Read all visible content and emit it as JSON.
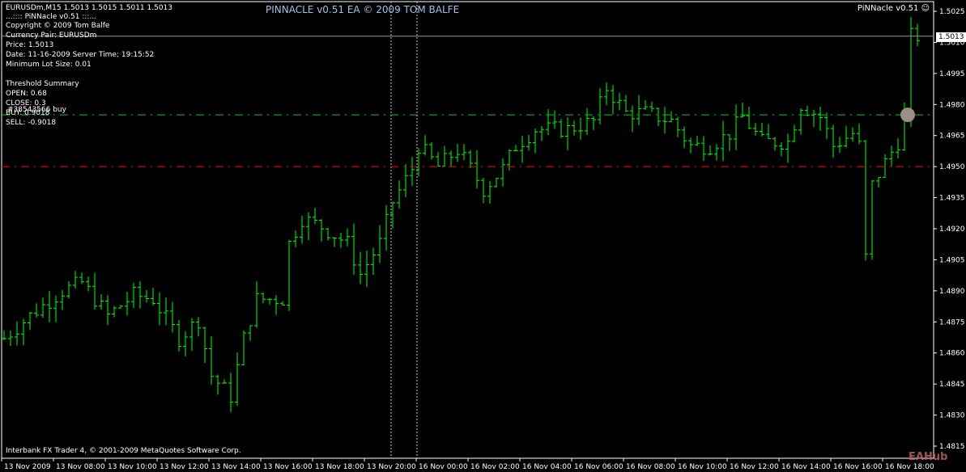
{
  "header": {
    "symbol_line": "EURUSDm,M15  1.5013 1.5015 1.5011 1.5013",
    "ea_name": "...:::: PiNNacle v0.51 :::...",
    "title": "PINNACLE v0.51 EA © 2009 TOM BALFE",
    "ea_badge": "PiNNacle v0.51 ☺"
  },
  "info": [
    "Copyright © 2009 Tom Balfe",
    "Currency Pair: EURUSDm",
    "Price:  1.5013",
    "Date: 11-16-2009 Server Time: 19:15:52",
    "Minimum Lot Size: 0.01",
    "",
    "Threshold Summary",
    "OPEN: 0.68",
    "CLOSE: 0.3",
    "BUY: 0.9018",
    "SELL: -0.9018"
  ],
  "order_label": "#38543566 buy",
  "current_price": "1.5013",
  "footer": "Interbank FX Trader 4, © 2001-2009 MetaQuotes Software Corp.",
  "watermark": "EAHub",
  "colors": {
    "bars": "#00ff00",
    "buy_line": "#00cc00",
    "sell_line": "#ff0000",
    "title": "#9cc3e6"
  },
  "chart_data": {
    "type": "ohlc",
    "timeframe": "M15",
    "price_levels": {
      "buy": 1.4975,
      "sell": 1.495,
      "current": 1.5013
    },
    "ylim": [
      1.481,
      1.503
    ],
    "y_ticks": [
      "1.5025",
      "1.5010",
      "1.4995",
      "1.4980",
      "1.4965",
      "1.4950",
      "1.4935",
      "1.4920",
      "1.4905",
      "1.4890",
      "1.4875",
      "1.4860",
      "1.4845",
      "1.4830",
      "1.4815"
    ],
    "x_ticks": [
      "13 Nov 2009",
      "13 Nov 08:00",
      "13 Nov 10:00",
      "13 Nov 12:00",
      "13 Nov 14:00",
      "13 Nov 16:00",
      "13 Nov 18:00",
      "13 Nov 20:00",
      "16 Nov 00:00",
      "16 Nov 02:00",
      "16 Nov 04:00",
      "16 Nov 06:00",
      "16 Nov 08:00",
      "16 Nov 10:00",
      "16 Nov 12:00",
      "16 Nov 14:00",
      "16 Nov 16:00",
      "16 Nov 18:00"
    ],
    "close_waypoints": [
      [
        0,
        1.4867
      ],
      [
        4,
        1.4878
      ],
      [
        9,
        1.489
      ],
      [
        12,
        1.4894
      ],
      [
        16,
        1.4878
      ],
      [
        20,
        1.4888
      ],
      [
        23,
        1.4886
      ],
      [
        27,
        1.4867
      ],
      [
        30,
        1.4876
      ],
      [
        32,
        1.4849
      ],
      [
        35,
        1.4839
      ],
      [
        37,
        1.4867
      ],
      [
        39,
        1.4886
      ],
      [
        43,
        1.4886
      ],
      [
        44,
        1.4913
      ],
      [
        46,
        1.4925
      ],
      [
        49,
        1.4921
      ],
      [
        53,
        1.4913
      ],
      [
        55,
        1.4898
      ],
      [
        58,
        1.4913
      ],
      [
        60,
        1.4933
      ],
      [
        63,
        1.4949
      ],
      [
        64,
        1.496
      ],
      [
        67,
        1.495
      ],
      [
        70,
        1.4958
      ],
      [
        72,
        1.4949
      ],
      [
        74,
        1.4939
      ],
      [
        77,
        1.4949
      ],
      [
        79,
        1.496
      ],
      [
        82,
        1.4968
      ],
      [
        87,
        1.4968
      ],
      [
        91,
        1.4972
      ],
      [
        93,
        1.4988
      ],
      [
        96,
        1.4976
      ],
      [
        99,
        1.4976
      ],
      [
        103,
        1.4972
      ],
      [
        106,
        1.496
      ],
      [
        109,
        1.496
      ],
      [
        112,
        1.4966
      ],
      [
        114,
        1.4974
      ],
      [
        117,
        1.4962
      ],
      [
        121,
        1.4962
      ],
      [
        123,
        1.498
      ],
      [
        126,
        1.4974
      ],
      [
        128,
        1.496
      ],
      [
        131,
        1.4966
      ],
      [
        132,
        1.496
      ],
      [
        133,
        1.4906
      ],
      [
        134,
        1.4941
      ],
      [
        136,
        1.4952
      ],
      [
        138,
        1.4962
      ],
      [
        139,
        1.4974
      ],
      [
        140,
        1.5013
      ],
      [
        141,
        1.5013
      ]
    ]
  }
}
